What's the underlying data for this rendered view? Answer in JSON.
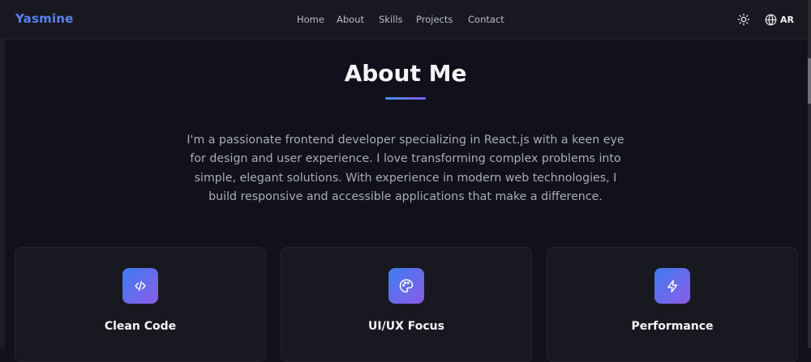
{
  "navbar": {
    "logo": "Yasmine",
    "links": [
      {
        "label": "Home"
      },
      {
        "label": "About"
      },
      {
        "label": "Skills"
      },
      {
        "label": "Projects"
      },
      {
        "label": "Contact"
      }
    ],
    "theme_icon": "sun-icon",
    "language": {
      "icon": "globe-icon",
      "label": "AR"
    }
  },
  "about": {
    "title": "About Me",
    "description": "I'm a passionate frontend developer specializing in React.js with a keen eye for design and user experience. I love transforming complex problems into simple, elegant solutions. With experience in modern web technologies, I build responsive and accessible applications that make a difference."
  },
  "features": [
    {
      "icon": "code-icon",
      "title": "Clean Code"
    },
    {
      "icon": "palette-icon",
      "title": "UI/UX Focus"
    },
    {
      "icon": "lightning-icon",
      "title": "Performance"
    }
  ],
  "colors": {
    "accent": "#5a7ff0",
    "background": "#10111a",
    "card": "#181920",
    "gradient_start": "#3f7cf0",
    "gradient_end": "#8a5ce6"
  }
}
